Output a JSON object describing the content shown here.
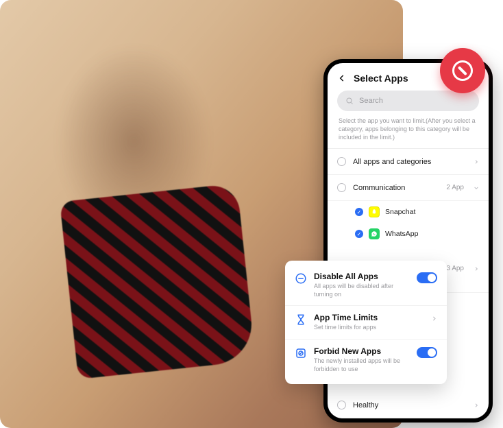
{
  "screen": {
    "title": "Select Apps",
    "search_placeholder": "Search",
    "helper": "Select the app you want to limit.(After you select a category, apps belonging to this category will be included in the limit.)"
  },
  "categories": [
    {
      "label": "All apps and categories",
      "meta": ""
    },
    {
      "label": "Communication",
      "meta": "2 App"
    },
    {
      "label": "",
      "meta": "3 App"
    },
    {
      "label": "Healthy",
      "meta": ""
    }
  ],
  "apps": [
    {
      "name": "Snapchat",
      "checked": true,
      "icon": "snap"
    },
    {
      "name": "WhatsApp",
      "checked": true,
      "icon": "wa"
    }
  ],
  "card": {
    "disable_title": "Disable All Apps",
    "disable_sub": "All apps will be disabled after turning on",
    "limits_title": "App Time Limits",
    "limits_sub": "Set time limits for apps",
    "forbid_title": "Forbid New Apps",
    "forbid_sub": "The newly installed apps will be forbidden to use"
  }
}
